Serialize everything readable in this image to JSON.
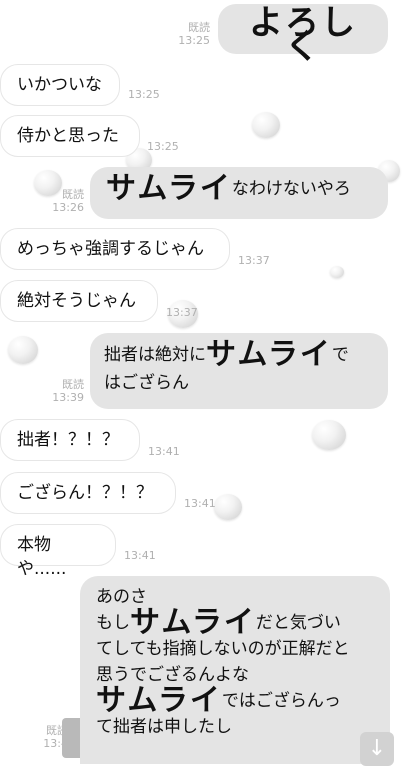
{
  "messages": {
    "m1": {
      "text": "よろしく",
      "read": "既読",
      "time": "13:25"
    },
    "m2": {
      "text": "いかついな",
      "time": "13:25"
    },
    "m3": {
      "text": "侍かと思った",
      "time": "13:25"
    },
    "m4": {
      "big": "サムライ",
      "rest": "なわけないやろ",
      "read": "既読",
      "time": "13:26"
    },
    "m5": {
      "text": "めっちゃ強調するじゃん",
      "time": "13:37"
    },
    "m6": {
      "text": "絶対そうじゃん",
      "time": "13:37"
    },
    "m7": {
      "pre": "拙者は絶対に",
      "big": "サムライ",
      "post": "で",
      "line2": "はござらん",
      "read": "既読",
      "time": "13:39"
    },
    "m8": {
      "text": "拙者！？！？",
      "time": "13:41"
    },
    "m9": {
      "text": "ござらん！？！？",
      "time": "13:41"
    },
    "m10": {
      "text": "本物や......",
      "time": "13:41"
    },
    "m11": {
      "line1": "あのさ",
      "line2_pre": "もし",
      "line2_big": "サムライ",
      "line2_post": "だと気づい",
      "line3": "てしても指摘しないのが正解だと",
      "line4": "思うでござるんよな",
      "line5_big": "サムライ",
      "line5_post": "ではござらんっ",
      "line6": "て拙者は申したし",
      "read": "既読",
      "time": "13:4"
    }
  },
  "scroll_button": {
    "icon": "arrow-down-icon",
    "glyph": "↓"
  }
}
